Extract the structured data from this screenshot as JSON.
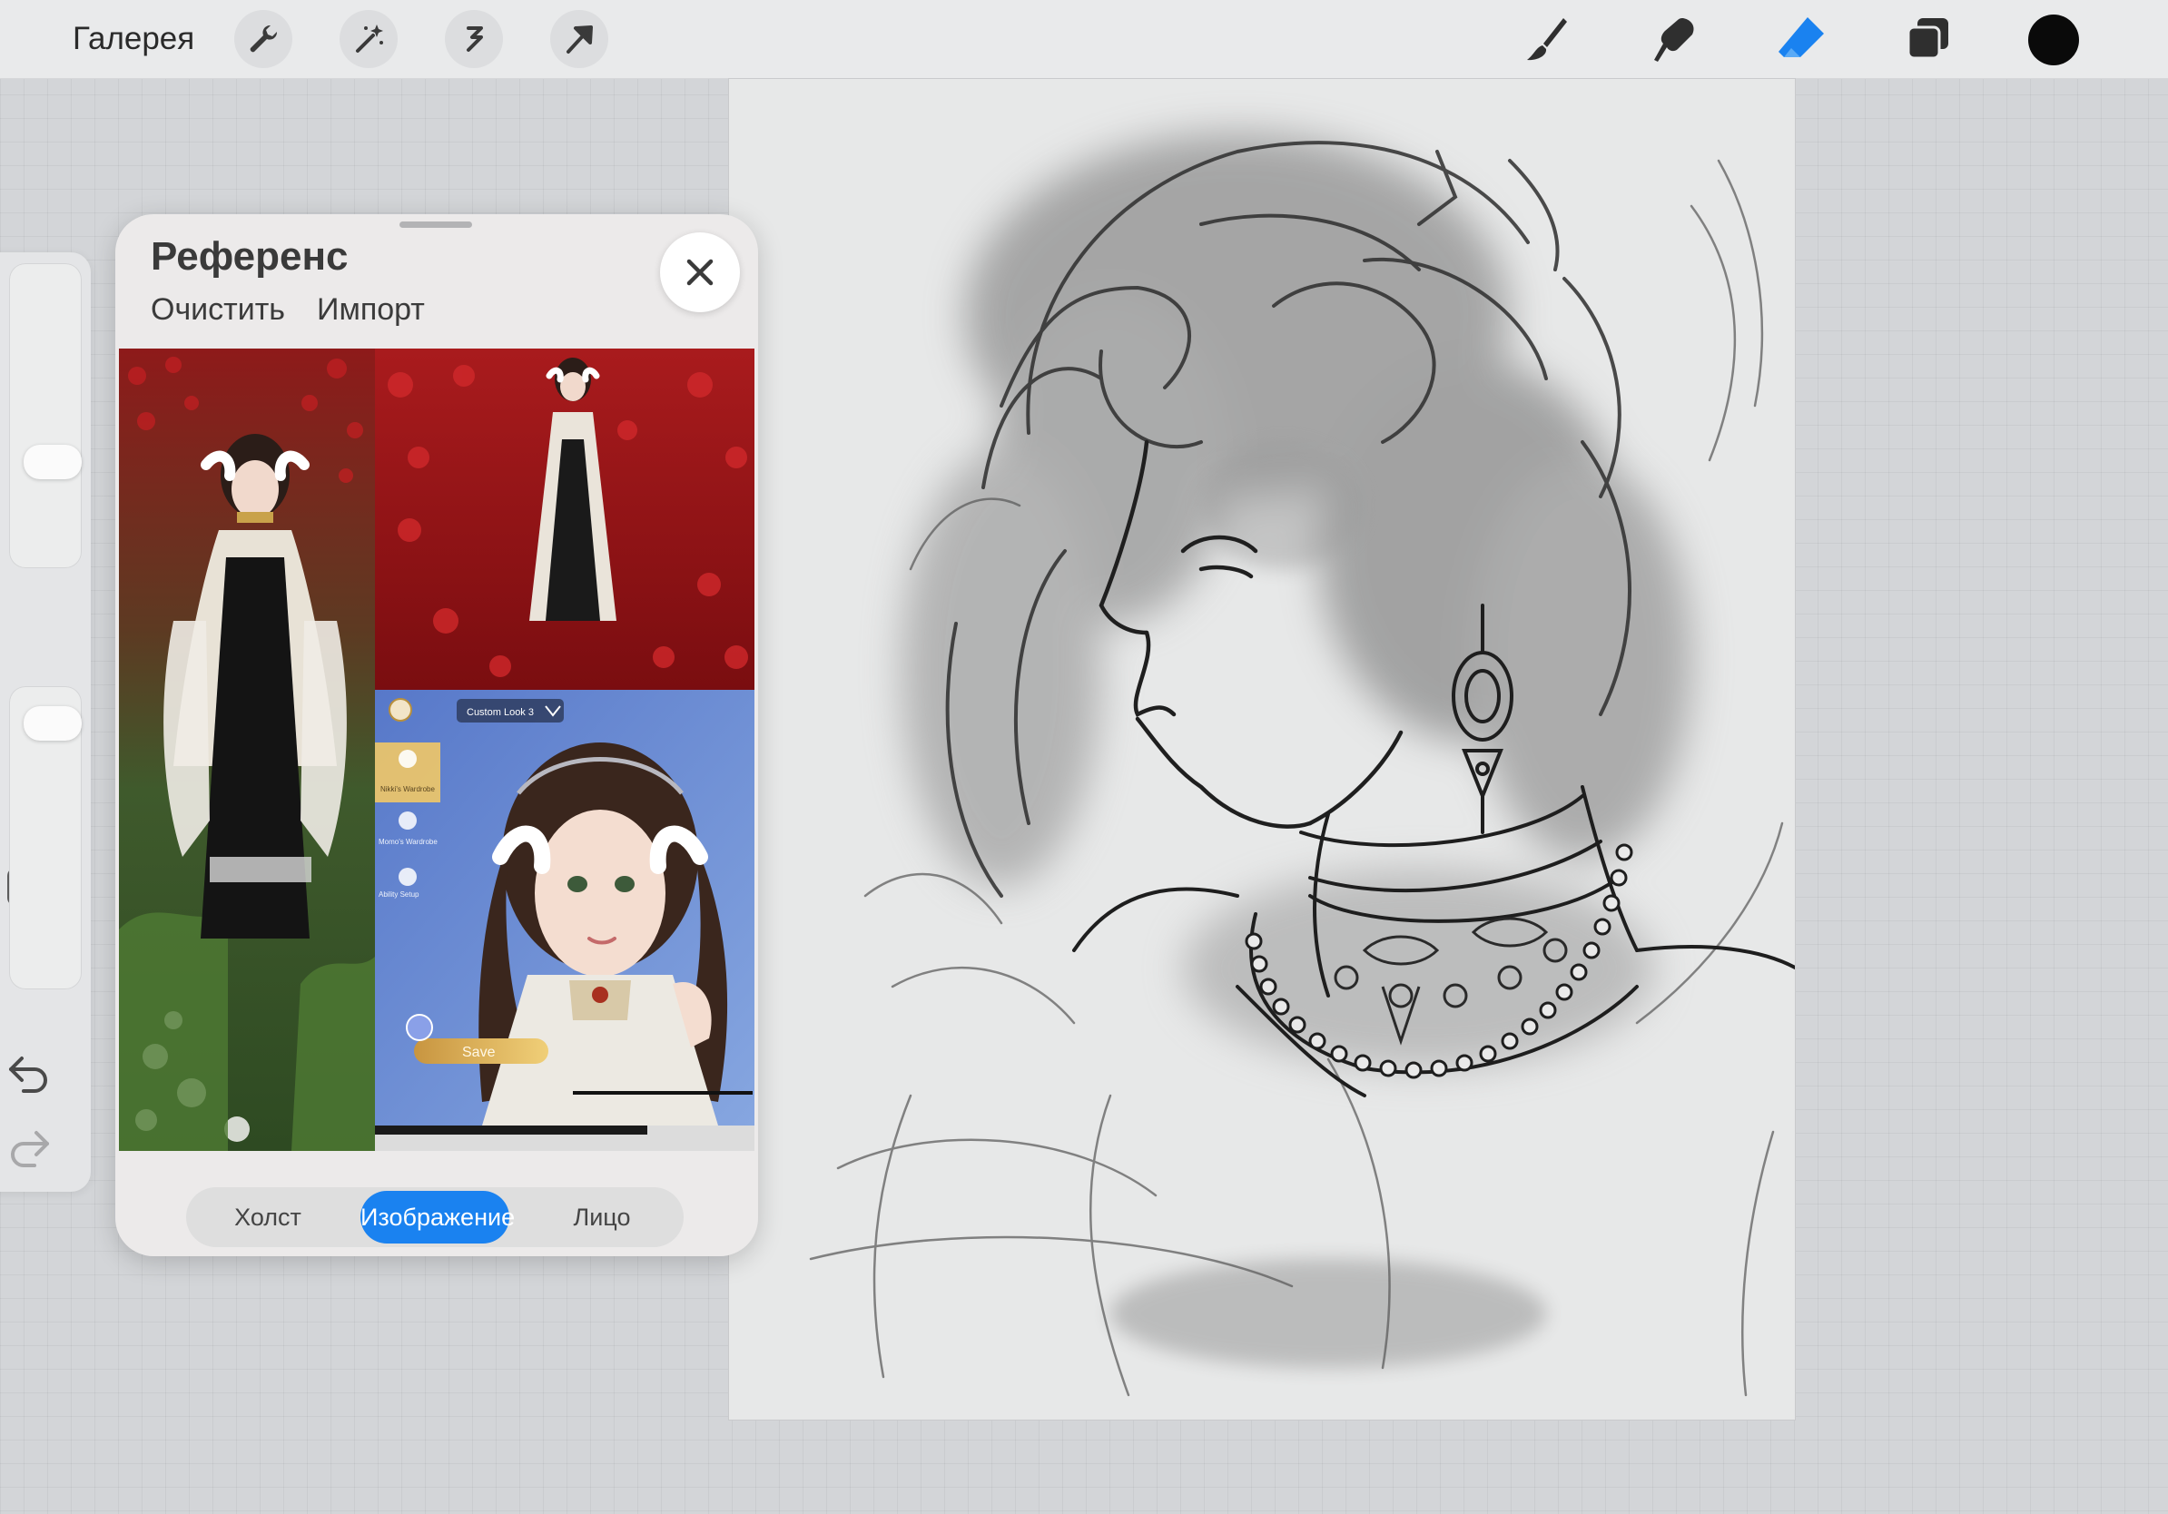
{
  "toolbar": {
    "gallery_label": "Галерея",
    "left_tools": [
      "wrench-icon",
      "magic-wand-icon",
      "selection-icon",
      "transform-arrow-icon"
    ],
    "right_tools": [
      "brush-icon",
      "smudge-icon",
      "eraser-icon",
      "layers-icon"
    ],
    "active_tool": "eraser-icon",
    "accent_color": "#1a82f0",
    "current_color": "#0a0a0a"
  },
  "sidebar": {
    "brush_size_slider": "slider",
    "modify_button": "square-icon",
    "opacity_slider": "slider",
    "undo": "undo-icon",
    "redo": "redo-icon"
  },
  "reference": {
    "title": "Референс",
    "clear_label": "Очистить",
    "import_label": "Импорт",
    "close_icon": "close-icon",
    "image_ui": {
      "dropdown_label": "Custom Look 3",
      "menu_items": [
        "Nikki's Wardrobe",
        "Momo's Wardrobe",
        "Ability Setup"
      ],
      "save_label": "Save"
    },
    "tabs": [
      "Холст",
      "Изображение",
      "Лицо"
    ],
    "active_tab": "Изображение"
  }
}
